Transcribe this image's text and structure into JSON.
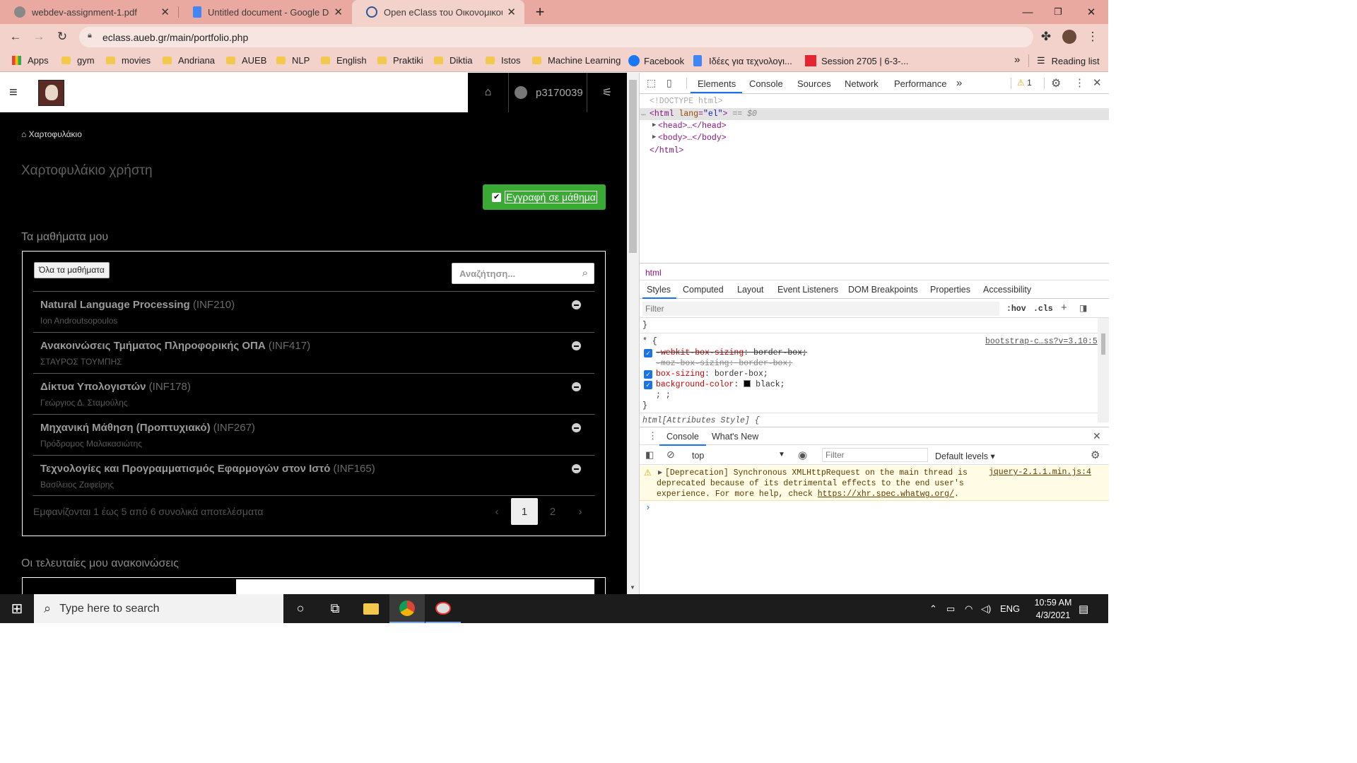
{
  "browser": {
    "tabs": [
      {
        "title": "webdev-assignment-1.pdf",
        "icon": "globe-icon"
      },
      {
        "title": "Untitled document - Google Doc",
        "icon": "docs-icon"
      },
      {
        "title": "Open eClass του Οικονομικού Π",
        "icon": "eclass-icon"
      }
    ],
    "new_tab": "+",
    "url": "eclass.aueb.gr/main/portfolio.php",
    "bookmarks": [
      "Apps",
      "gym",
      "movies",
      "Andriana",
      "AUEB",
      "NLP",
      "English",
      "Praktiki",
      "Diktia",
      "Istos",
      "Machine Learning",
      "Facebook",
      "Ιδέες για τεχνολογι...",
      "Session 2705 | 6-3-..."
    ],
    "more_bookmarks": "»",
    "reading_list": "Reading list"
  },
  "page": {
    "username": "p3170039",
    "breadcrumb": "Χαρτοφυλάκιο",
    "title": "Χαρτοφυλάκιο χρήστη",
    "register_button": "Εγγραφή σε μάθημα",
    "my_courses": "Τα μαθήματα μου",
    "all_courses_button": "Όλα τα μαθήματα",
    "search_placeholder": "Αναζήτηση...",
    "courses": [
      {
        "name": "Natural Language Processing",
        "code": "(INF210)",
        "instructor": "Ion Androutsopoulos"
      },
      {
        "name": "Ανακοινώσεις Τμήματος Πληροφορικής ΟΠΑ",
        "code": "(INF417)",
        "instructor": "ΣΤΑΥΡΟΣ ΤΟΥΜΠΗΣ"
      },
      {
        "name": "Δίκτυα Υπολογιστών",
        "code": "(INF178)",
        "instructor": "Γεώργιος Δ. Σταμούλης"
      },
      {
        "name": "Μηχανική Μάθηση (Προπτυχιακό)",
        "code": "(INF267)",
        "instructor": "Πρόδρομος Μαλακασιώτης"
      },
      {
        "name": "Τεχνολογίες και Προγραμματισμός Εφαρμογών στον Ιστό",
        "code": "(INF165)",
        "instructor": "Βασίλειος Ζαφείρης"
      }
    ],
    "showing": "Εμφανίζονται 1 έως 5 από 6 συνολικά αποτελέσματα",
    "pagination": {
      "prev": "‹",
      "pages": [
        "1",
        "2"
      ],
      "next": "›",
      "current": "1"
    },
    "announcements": "Οι τελευταίες μου ανακοινώσεις"
  },
  "devtools": {
    "tabs": [
      "Elements",
      "Console",
      "Sources",
      "Network",
      "Performance",
      "»"
    ],
    "warnings": "1",
    "dom": {
      "doctype": "<!DOCTYPE html>",
      "html_open_tag": "<html",
      "html_attr_name": "lang",
      "html_attr_eq": "=",
      "html_attr_value": "\"el\"",
      "html_open_close": ">",
      "selected_marker": "== $0",
      "head": "<head>…</head>",
      "body": "<body>…</body>",
      "html_close": "</html>"
    },
    "breadcrumb": "html",
    "style_tabs": [
      "Styles",
      "Computed",
      "Layout",
      "Event Listeners",
      "DOM Breakpoints",
      "Properties",
      "Accessibility"
    ],
    "filter_placeholder": "Filter",
    "hov": ":hov",
    "cls": ".cls",
    "rule_selector": "* {",
    "rule_source": "bootstrap-c…ss?v=3.10:5",
    "declarations": [
      {
        "prop": "-webkit-box-sizing",
        "value": "border-box;"
      },
      {
        "prop": "-moz-box-sizing",
        "value": "border-box;"
      },
      {
        "prop": "box-sizing",
        "value": "border-box;"
      },
      {
        "prop": "background-color",
        "value": "black;"
      },
      {
        "prop": ";",
        "value": ";"
      }
    ],
    "close_brace": "}",
    "attr_style_rule": "html[Attributes Style] {",
    "drawer_tabs": [
      "Console",
      "What's New"
    ],
    "context": "top",
    "console_filter_placeholder": "Filter",
    "levels": "Default levels ▾",
    "warning_message": "[Deprecation] Synchronous XMLHttpRequest on the main thread is deprecated because of its detrimental effects to the end user's experience. For more help, check",
    "warning_link": "https://xhr.spec.whatwg.org/",
    "warning_period": ".",
    "warning_source": "jquery-2.1.1.min.js:4",
    "prompt": "›"
  },
  "taskbar": {
    "search_placeholder": "Type here to search",
    "lang": "ENG",
    "time": "10:59 AM",
    "date": "4/3/2021"
  }
}
